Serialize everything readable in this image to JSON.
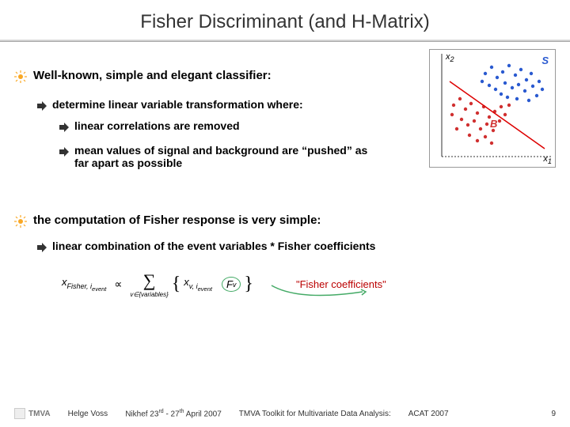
{
  "title": "Fisher Discriminant (and H-Matrix)",
  "bullets": {
    "b1": "Well-known, simple and elegant classifier:",
    "b1a": "determine linear variable transformation where:",
    "b1a1": "linear correlations are removed",
    "b1a2": "mean values of signal and background are “pushed” as far apart as possible",
    "b2": "the computation of Fisher response is very simple:",
    "b2a": "linear combination of the event variables * Fisher coefficients"
  },
  "formula": {
    "lhs_x": "x",
    "lhs_sub1": "Fisher,",
    "lhs_sub2": "i",
    "lhs_sub3": "event",
    "prop": "∝",
    "sum_under": "v∈{variables}",
    "term_x": "x",
    "term_sub": "v, i",
    "term_sub2": "event",
    "fv": "F",
    "fv_sub": "v",
    "coef_label": "\"Fisher coefficients\""
  },
  "scatter": {
    "y_label": "x",
    "y_sub": "2",
    "x_label": "x",
    "x_sub": "1",
    "s_label": "S",
    "b_label": "B"
  },
  "footer": {
    "tmva": "TMVA",
    "author": "Helge Voss",
    "venue_pre": "Nikhef  23",
    "venue_sup1": "rd",
    "venue_mid": " - 27",
    "venue_sup2": "th",
    "venue_post": " April 2007",
    "talk": "TMVA Toolkit for Multivariate Data Analysis:",
    "conf": "ACAT 2007",
    "page": "9"
  }
}
